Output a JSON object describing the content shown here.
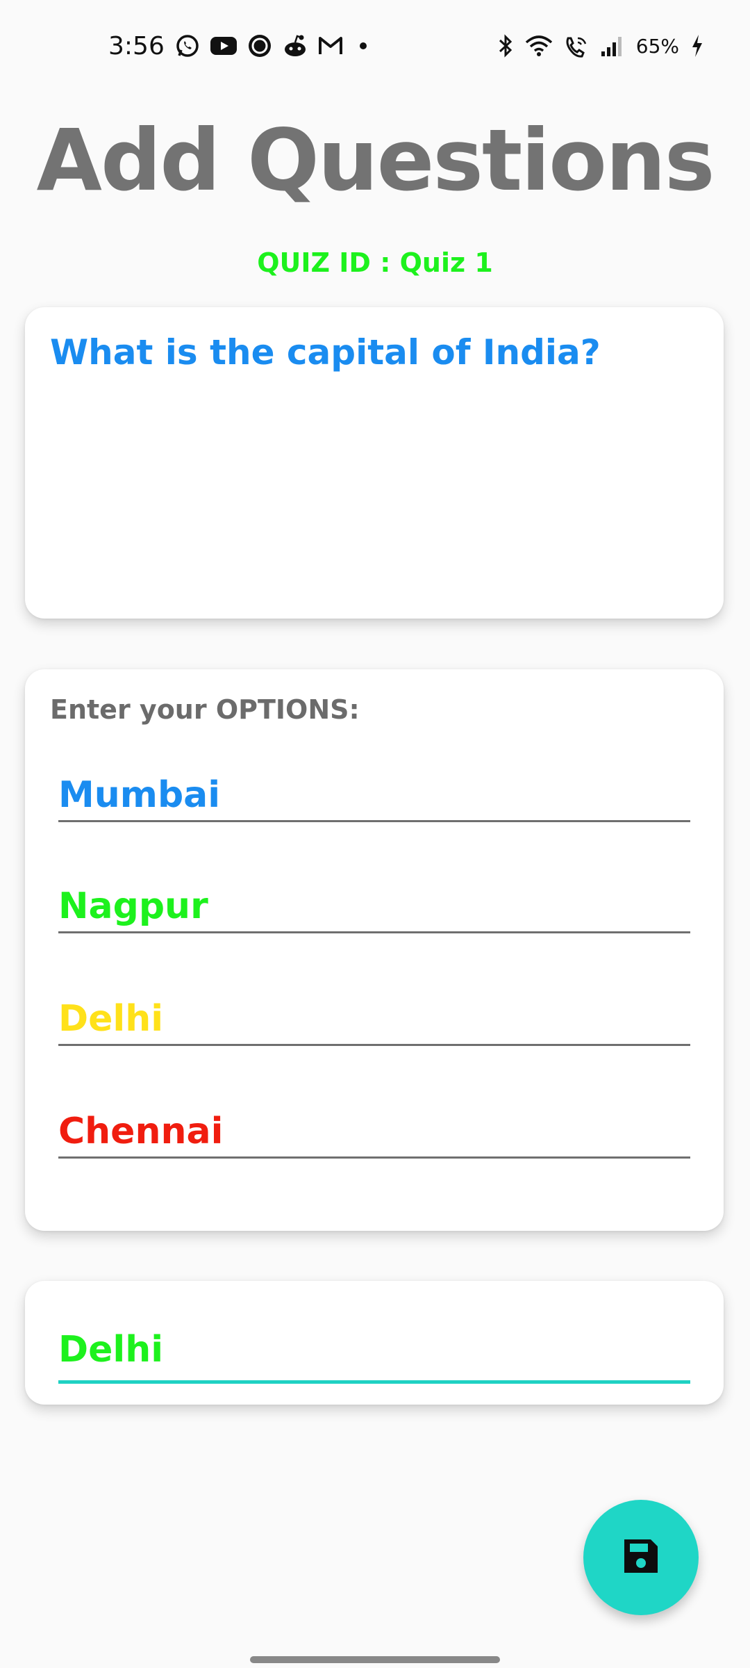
{
  "status_bar": {
    "time": "3:56",
    "battery": "65%",
    "left_icons": [
      "whatsapp-icon",
      "youtube-icon",
      "ring-app-icon",
      "reddit-icon",
      "gmail-icon",
      "dot-icon"
    ],
    "right_icons": [
      "bluetooth-icon",
      "wifi-icon",
      "wifi-calling-icon",
      "signal-icon",
      "charging-icon"
    ]
  },
  "header": {
    "title": "Add Questions",
    "quiz_id": "QUIZ ID : Quiz 1"
  },
  "question": {
    "text": "What is the capital of India?"
  },
  "options": {
    "label": "Enter your OPTIONS:",
    "items": [
      {
        "value": "Mumbai",
        "color": "#1a8cf0"
      },
      {
        "value": "Nagpur",
        "color": "#1df11d"
      },
      {
        "value": "Delhi",
        "color": "#ffe11a"
      },
      {
        "value": "Chennai",
        "color": "#f01d0f"
      }
    ]
  },
  "answer": {
    "value": "Delhi",
    "color": "#1df11d",
    "underline_color": "#1fd2c3"
  },
  "fab": {
    "icon": "save-icon",
    "color": "#1fd6c6"
  },
  "colors": {
    "title": "#737373",
    "quiz_id": "#1df11d",
    "question": "#1a8cf0"
  }
}
